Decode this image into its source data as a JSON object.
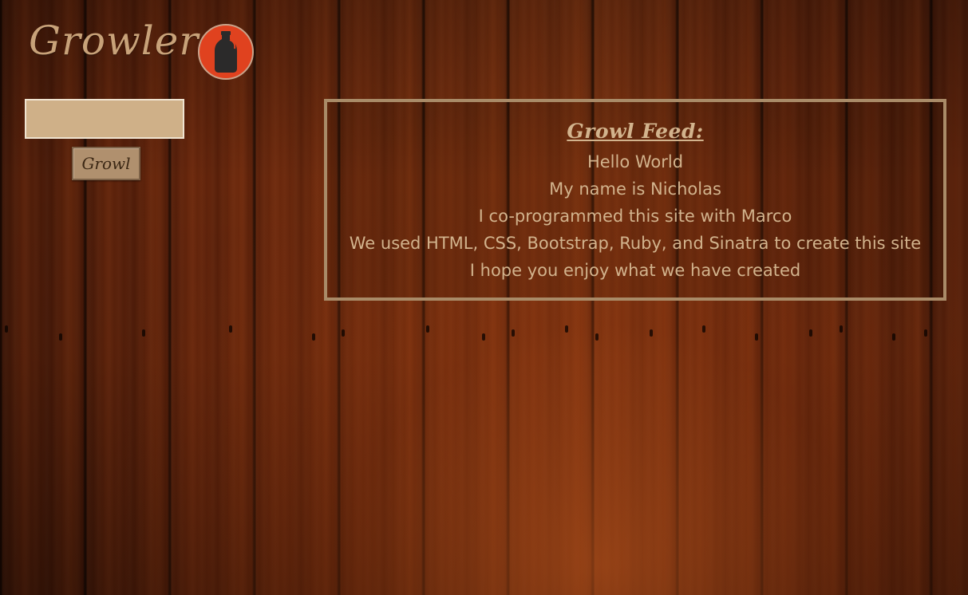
{
  "header": {
    "brand": "Growler",
    "logo_icon": "growler-jug-icon"
  },
  "compose": {
    "input_value": "",
    "input_placeholder": "",
    "button_label": "Growl"
  },
  "feed": {
    "title": "Growl Feed:",
    "items": [
      "Hello World",
      "My name is Nicholas",
      "I co-programmed this site with Marco",
      "We used HTML, CSS, Bootstrap, Ruby, and Sinatra to create this site",
      "I hope you enjoy what we have created"
    ]
  },
  "colors": {
    "accent_text": "#c8a279",
    "logo_background": "#e0421f",
    "input_background": "#cfb088",
    "button_background": "#b0906e",
    "feed_border": "#a98b68",
    "wood_background": "#5a200a"
  }
}
